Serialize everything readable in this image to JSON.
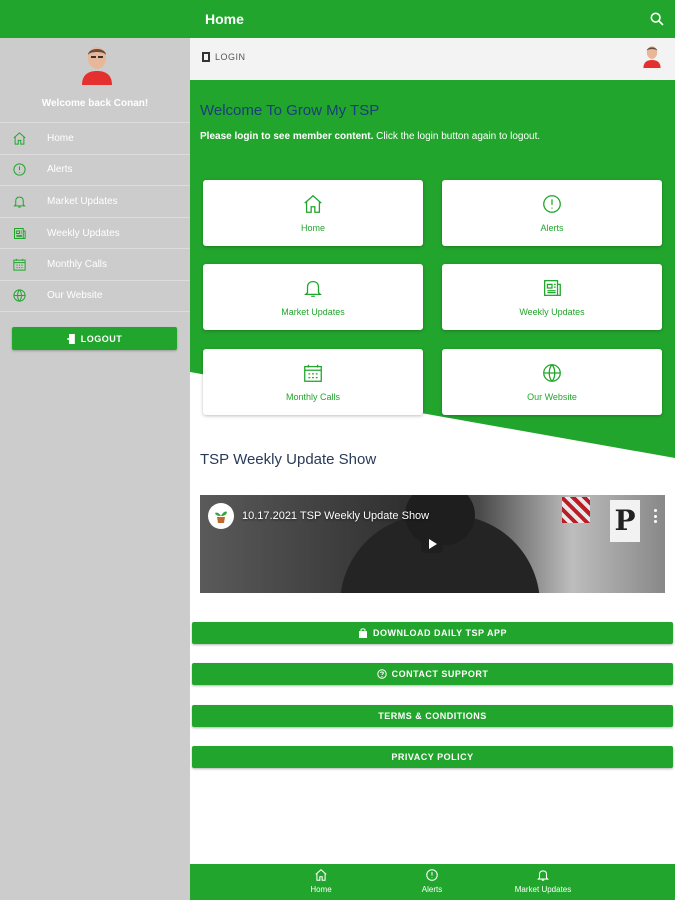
{
  "app": {
    "page_title": "Home",
    "accent_color": "#22a52c",
    "heading_color": "#1a3f7a"
  },
  "sidebar": {
    "welcome": "Welcome back Conan!",
    "items": [
      {
        "label": "Home",
        "icon": "home-icon"
      },
      {
        "label": "Alerts",
        "icon": "alert-circle-icon"
      },
      {
        "label": "Market Updates",
        "icon": "bell-icon"
      },
      {
        "label": "Weekly Updates",
        "icon": "newspaper-icon"
      },
      {
        "label": "Monthly Calls",
        "icon": "calendar-icon"
      },
      {
        "label": "Our Website",
        "icon": "globe-icon"
      }
    ],
    "logout_label": "LOGOUT"
  },
  "topbar": {
    "search_icon": "search-icon"
  },
  "loginbar": {
    "login_label": "LOGIN"
  },
  "hero": {
    "title": "Welcome To Grow My TSP",
    "subtitle_bold": "Please login to see member content.",
    "subtitle_rest": " Click the login button again to logout."
  },
  "tiles": [
    {
      "label": "Home",
      "icon": "home-icon"
    },
    {
      "label": "Alerts",
      "icon": "alert-circle-icon"
    },
    {
      "label": "Market Updates",
      "icon": "bell-icon"
    },
    {
      "label": "Weekly Updates",
      "icon": "newspaper-icon"
    },
    {
      "label": "Monthly Calls",
      "icon": "calendar-icon"
    },
    {
      "label": "Our Website",
      "icon": "globe-icon"
    }
  ],
  "video_section": {
    "title": "TSP Weekly Update Show",
    "video_title": "10.17.2021 TSP Weekly Update Show",
    "sign_letter": "P"
  },
  "actions": {
    "download_app": "DOWNLOAD DAILY TSP APP",
    "contact_support": "CONTACT SUPPORT",
    "terms": "TERMS & CONDITIONS",
    "privacy": "PRIVACY POLICY"
  },
  "bottom_nav": [
    {
      "label": "Home",
      "icon": "home-icon"
    },
    {
      "label": "Alerts",
      "icon": "alert-circle-icon"
    },
    {
      "label": "Market Updates",
      "icon": "bell-icon"
    }
  ]
}
